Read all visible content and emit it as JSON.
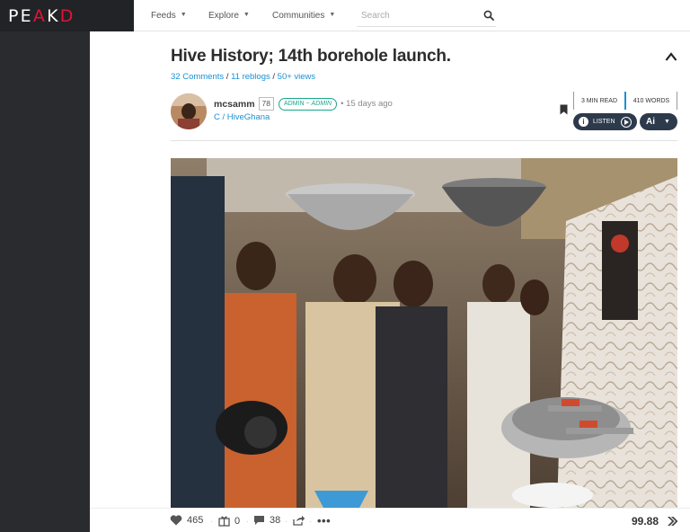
{
  "brand": {
    "logo_text_a": "PE",
    "logo_text_b": "A",
    "logo_text_c": "K",
    "logo_text_d": "D"
  },
  "nav": {
    "items": [
      {
        "label": "Feeds"
      },
      {
        "label": "Explore"
      },
      {
        "label": "Communities"
      }
    ],
    "search_placeholder": "Search"
  },
  "post": {
    "title": "Hive History; 14th borehole launch.",
    "comments": "32 Comments",
    "reblogs": "11 reblogs",
    "views": "50+ views",
    "author": "mcsamm",
    "reputation": "78",
    "role_prefix": "ADMIN ~ ",
    "role_italic": "ADMIN",
    "time_ago": "15 days ago",
    "community": "C / HiveGhana",
    "read_time": "3 MIN READ",
    "word_count": "410 WORDS",
    "listen_label": "LISTEN",
    "ai_label": "Ai"
  },
  "footer": {
    "likes": "465",
    "reblog_count": "0",
    "comment_count": "38",
    "payout": "99.88"
  },
  "colors": {
    "brand_red": "#e31337",
    "link_blue": "#1a8fd6",
    "sidebar_dark": "#2a2b2e",
    "button_navy": "#2c3a4c",
    "role_teal": "#1aa58a"
  }
}
